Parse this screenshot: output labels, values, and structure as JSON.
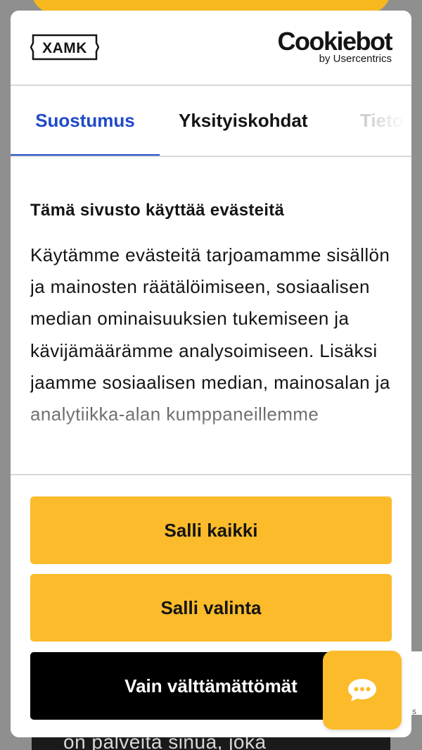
{
  "brand": {
    "site_logo_text": "XAMK",
    "provider_logo_text": "Cookiebot",
    "provider_logo_sub": "by Usercentrics",
    "accent_color": "#1f4ac7",
    "button_color": "#fbbb2b"
  },
  "tabs": [
    {
      "label": "Suostumus",
      "active": true
    },
    {
      "label": "Yksityiskohdat",
      "active": false
    },
    {
      "label": "Tieto",
      "active": false
    }
  ],
  "content": {
    "title": "Tämä sivusto käyttää evästeitä",
    "body": "Käytämme evästeitä tarjoamamme sisällön ja mainosten räätälöimiseen, sosiaalisen median ominaisuuksien tukemiseen ja kävijämäärämme analysoimiseen. Lisäksi jaamme sosiaalisen median, mainosalan ja analytiikka-alan kumppaneillemme"
  },
  "buttons": {
    "allow_all": "Salli kaikki",
    "allow_selection": "Salli valinta",
    "necessary_only": "Vain välttämättömät"
  },
  "background": {
    "partial_text": "on palveita sinua, joka"
  },
  "chat": {
    "icon": "chat-bubble-icon"
  }
}
